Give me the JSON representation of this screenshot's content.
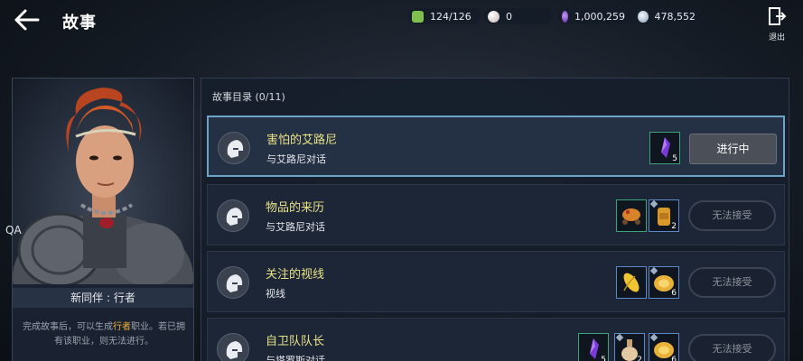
{
  "header": {
    "title": "故事",
    "resources": [
      {
        "name": "energy",
        "value": "124/126",
        "color": "#7fbf4d"
      },
      {
        "name": "pearl",
        "value": "0",
        "color": "#d8c8c8"
      },
      {
        "name": "purple-gem",
        "value": "1,000,259",
        "color": "#8a52d6"
      },
      {
        "name": "silver",
        "value": "478,552",
        "color": "#b7c6d6"
      }
    ],
    "exit_label": "退出"
  },
  "character": {
    "name": "新同伴 : 行者",
    "desc_part1": "完成故事后，可以生成",
    "desc_highlight": "行者",
    "desc_part2": "职业。若已拥有该职业，则无法进行。",
    "qa_label": "QA"
  },
  "story_list": {
    "header": "故事目录 (0/11)",
    "quests": [
      {
        "title": "害怕的艾路尼",
        "subtitle": "与艾路尼对话",
        "status": "进行中",
        "active": true,
        "rewards": [
          {
            "icon": "purple-crystal-icon",
            "count": "5",
            "style": "green"
          }
        ]
      },
      {
        "title": "物品的来历",
        "subtitle": "与艾路尼对话",
        "status": "无法接受",
        "active": false,
        "rewards": [
          {
            "icon": "pumpkin-cart-icon",
            "count": "",
            "style": "green"
          },
          {
            "icon": "backpack-icon",
            "count": "2",
            "style": "blue"
          }
        ]
      },
      {
        "title": "关注的视线",
        "subtitle": "视线",
        "status": "无法接受",
        "active": false,
        "rewards": [
          {
            "icon": "corn-icon",
            "count": "",
            "style": "blue"
          },
          {
            "icon": "gold-plate-icon",
            "count": "6",
            "style": "blue"
          }
        ]
      },
      {
        "title": "自卫队队长",
        "subtitle": "与塔罗斯对话",
        "status": "无法接受",
        "active": false,
        "rewards": [
          {
            "icon": "purple-crystal-icon",
            "count": "5",
            "style": "green"
          },
          {
            "icon": "flask-icon",
            "count": "2",
            "style": "blue"
          },
          {
            "icon": "gold-plate-icon",
            "count": "6",
            "style": "blue"
          }
        ]
      }
    ]
  }
}
